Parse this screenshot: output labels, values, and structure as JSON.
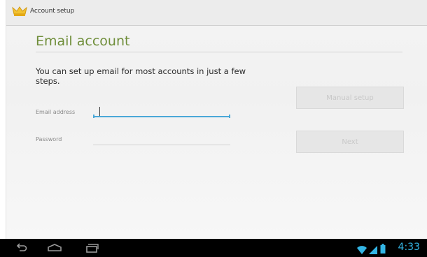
{
  "action_bar": {
    "title": "Account setup",
    "icon": "account-setup-icon"
  },
  "main": {
    "title": "Email account",
    "intro_text": "You can set up email for most accounts in just a few steps.",
    "email_label": "Email address",
    "email_value": "",
    "password_label": "Password",
    "password_value": "",
    "manual_setup_label": "Manual setup",
    "next_label": "Next"
  },
  "system_bar": {
    "time": "4:33",
    "nav_icons": [
      "back-icon",
      "home-icon",
      "recent-apps-icon"
    ],
    "status_icons": [
      "wifi-icon",
      "signal-icon",
      "battery-icon"
    ]
  },
  "colors": {
    "accent_green": "#6f8e3a",
    "focus_blue": "#4aa8d8",
    "status_blue": "#33b5e5"
  }
}
